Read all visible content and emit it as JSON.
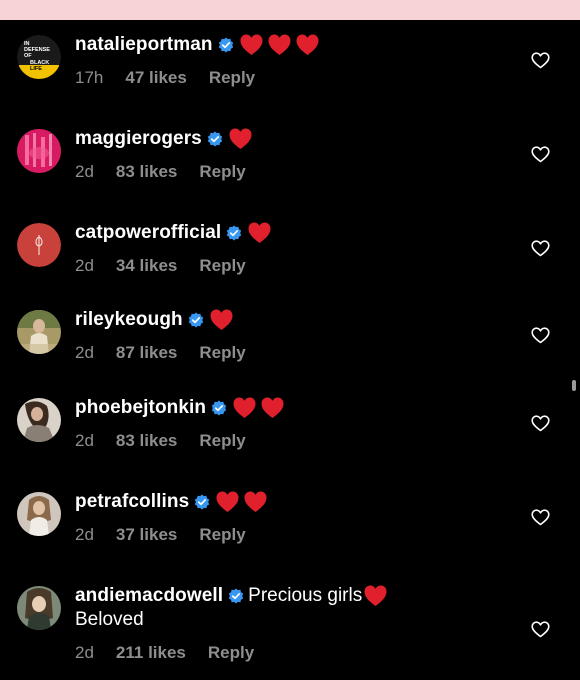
{
  "colors": {
    "page_background": "#f8d3d6",
    "panel_background": "#000000",
    "meta_gray": "#8e8e8e",
    "verified_blue": "#3897f0",
    "heart_red": "#e0202c"
  },
  "comments": [
    {
      "username": "natalieportman",
      "text": "",
      "text2": "",
      "hearts": 3,
      "time": "17h",
      "likes": "47 likes",
      "reply": "Reply",
      "avatar": {
        "kind": "text-logo",
        "lines": [
          "IN",
          "DEFENSE",
          "OF",
          "BLACK",
          "LIFE"
        ]
      }
    },
    {
      "username": "maggierogers",
      "text": "",
      "text2": "",
      "hearts": 1,
      "time": "2d",
      "likes": "83 likes",
      "reply": "Reply",
      "avatar": {
        "kind": "pink-photo"
      }
    },
    {
      "username": "catpowerofficial",
      "text": "",
      "text2": "",
      "hearts": 1,
      "time": "2d",
      "likes": "34 likes",
      "reply": "Reply",
      "avatar": {
        "kind": "red-symbol"
      }
    },
    {
      "username": "rileykeough",
      "text": "",
      "text2": "",
      "hearts": 1,
      "time": "2d",
      "likes": "87 likes",
      "reply": "Reply",
      "avatar": {
        "kind": "photo"
      }
    },
    {
      "username": "phoebejtonkin",
      "text": "",
      "text2": "",
      "hearts": 2,
      "time": "2d",
      "likes": "83 likes",
      "reply": "Reply",
      "avatar": {
        "kind": "photo"
      }
    },
    {
      "username": "petrafcollins",
      "text": "",
      "text2": "",
      "hearts": 2,
      "time": "2d",
      "likes": "37 likes",
      "reply": "Reply",
      "avatar": {
        "kind": "photo"
      }
    },
    {
      "username": "andiemacdowell",
      "text": "Precious girls",
      "text2": "Beloved",
      "hearts": 1,
      "time": "2d",
      "likes": "211 likes",
      "reply": "Reply",
      "avatar": {
        "kind": "photo"
      }
    }
  ]
}
